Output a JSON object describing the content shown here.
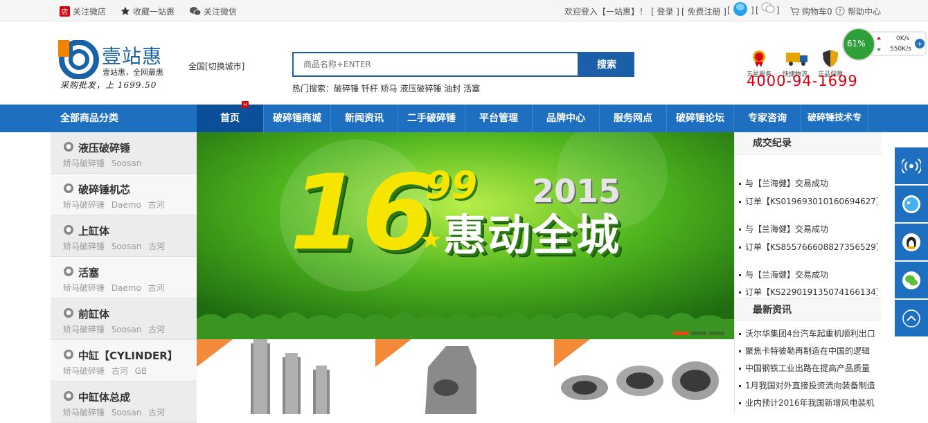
{
  "topbar": {
    "follow_weibo": "关注微店",
    "bookmark": "收藏一站惠",
    "follow_weixin": "关注微信",
    "welcome": "欢迎登入【一站惠】！",
    "login": "[ 登录 ]",
    "register": "[ 免费注册 ]",
    "bracket_open_1": "[",
    "bracket_close_1": "]",
    "bracket_open_2": "[",
    "bracket_close_2": "]",
    "cart": "购物车0",
    "help": "帮助中心"
  },
  "logo": {
    "name": "壹站惠",
    "sub": "壹站惠，全网最惠",
    "slogan": "采购批发，上 1699.50"
  },
  "city": "全国[切换城市]",
  "search": {
    "placeholder": "商品名称+ENTER",
    "button": "搜索",
    "hot_label": "热门搜索：",
    "hot_terms": "破碎锤 钎杆 矫马 液压破碎锤 油封 活塞"
  },
  "services": [
    {
      "label": "五星服务",
      "icon": "medal-icon"
    },
    {
      "label": "快捷物流",
      "icon": "truck-icon"
    },
    {
      "label": "正品保障",
      "icon": "shield-icon"
    }
  ],
  "hotline": "4000-94-1699",
  "speed_widget": {
    "percent": "61%",
    "up": "0K/s",
    "down": "550K/s"
  },
  "nav": {
    "all_categories": "全部商品分类",
    "items": [
      "首页",
      "破碎锤商城",
      "新闻资讯",
      "二手破碎锤",
      "平台管理",
      "品牌中心",
      "服务网点",
      "破碎锤论坛",
      "专家咨询",
      "破碎锤技术专"
    ],
    "badge": "H"
  },
  "categories": [
    {
      "title": "液压破碎锤",
      "sub": "矫马破碎锤 Soosan"
    },
    {
      "title": "破碎锤机芯",
      "sub": "矫马破碎锤 Daemo 古河"
    },
    {
      "title": "上缸体",
      "sub": "矫马破碎锤 Soosan 古河"
    },
    {
      "title": "活塞",
      "sub": "矫马破碎锤 Daemo 古河"
    },
    {
      "title": "前缸体",
      "sub": "矫马破碎锤 Soosan 古河"
    },
    {
      "title": "中缸【CYLINDER】",
      "sub": "矫马破碎锤 古河 GB"
    },
    {
      "title": "中缸体总成",
      "sub": "矫马破碎锤 Soosan 古河"
    }
  ],
  "banner": {
    "number": "16",
    "superscript": "99",
    "year": "2015",
    "slogan": "惠动全城"
  },
  "deals": {
    "title": "成交纪录",
    "lines": [
      "与【兰海健】交易成功",
      "订单【KS019693010160694627】",
      "与【兰海健】交易成功",
      "订单【KS855766608827356529】",
      "与【兰海健】交易成功",
      "订单【KS229019135074166134】"
    ]
  },
  "news": {
    "title": "最新资讯",
    "lines": [
      "沃尔华集团4台汽车起重机顺利出口",
      "聚焦卡特彼勒再制造在中国的逻辑",
      "中国钢铁工业出路在提高产品质量",
      "1月我国对外直接投资流向装备制造",
      "业内预计2016年我国新增风电装机"
    ]
  },
  "floating": [
    "signal-icon",
    "qq-bubble-icon",
    "penguin-icon",
    "wechat-icon",
    "back-to-top-icon"
  ],
  "colors": {
    "primary": "#1e6fc0",
    "dark": "#0b4f99",
    "hotline": "#d7000f"
  }
}
